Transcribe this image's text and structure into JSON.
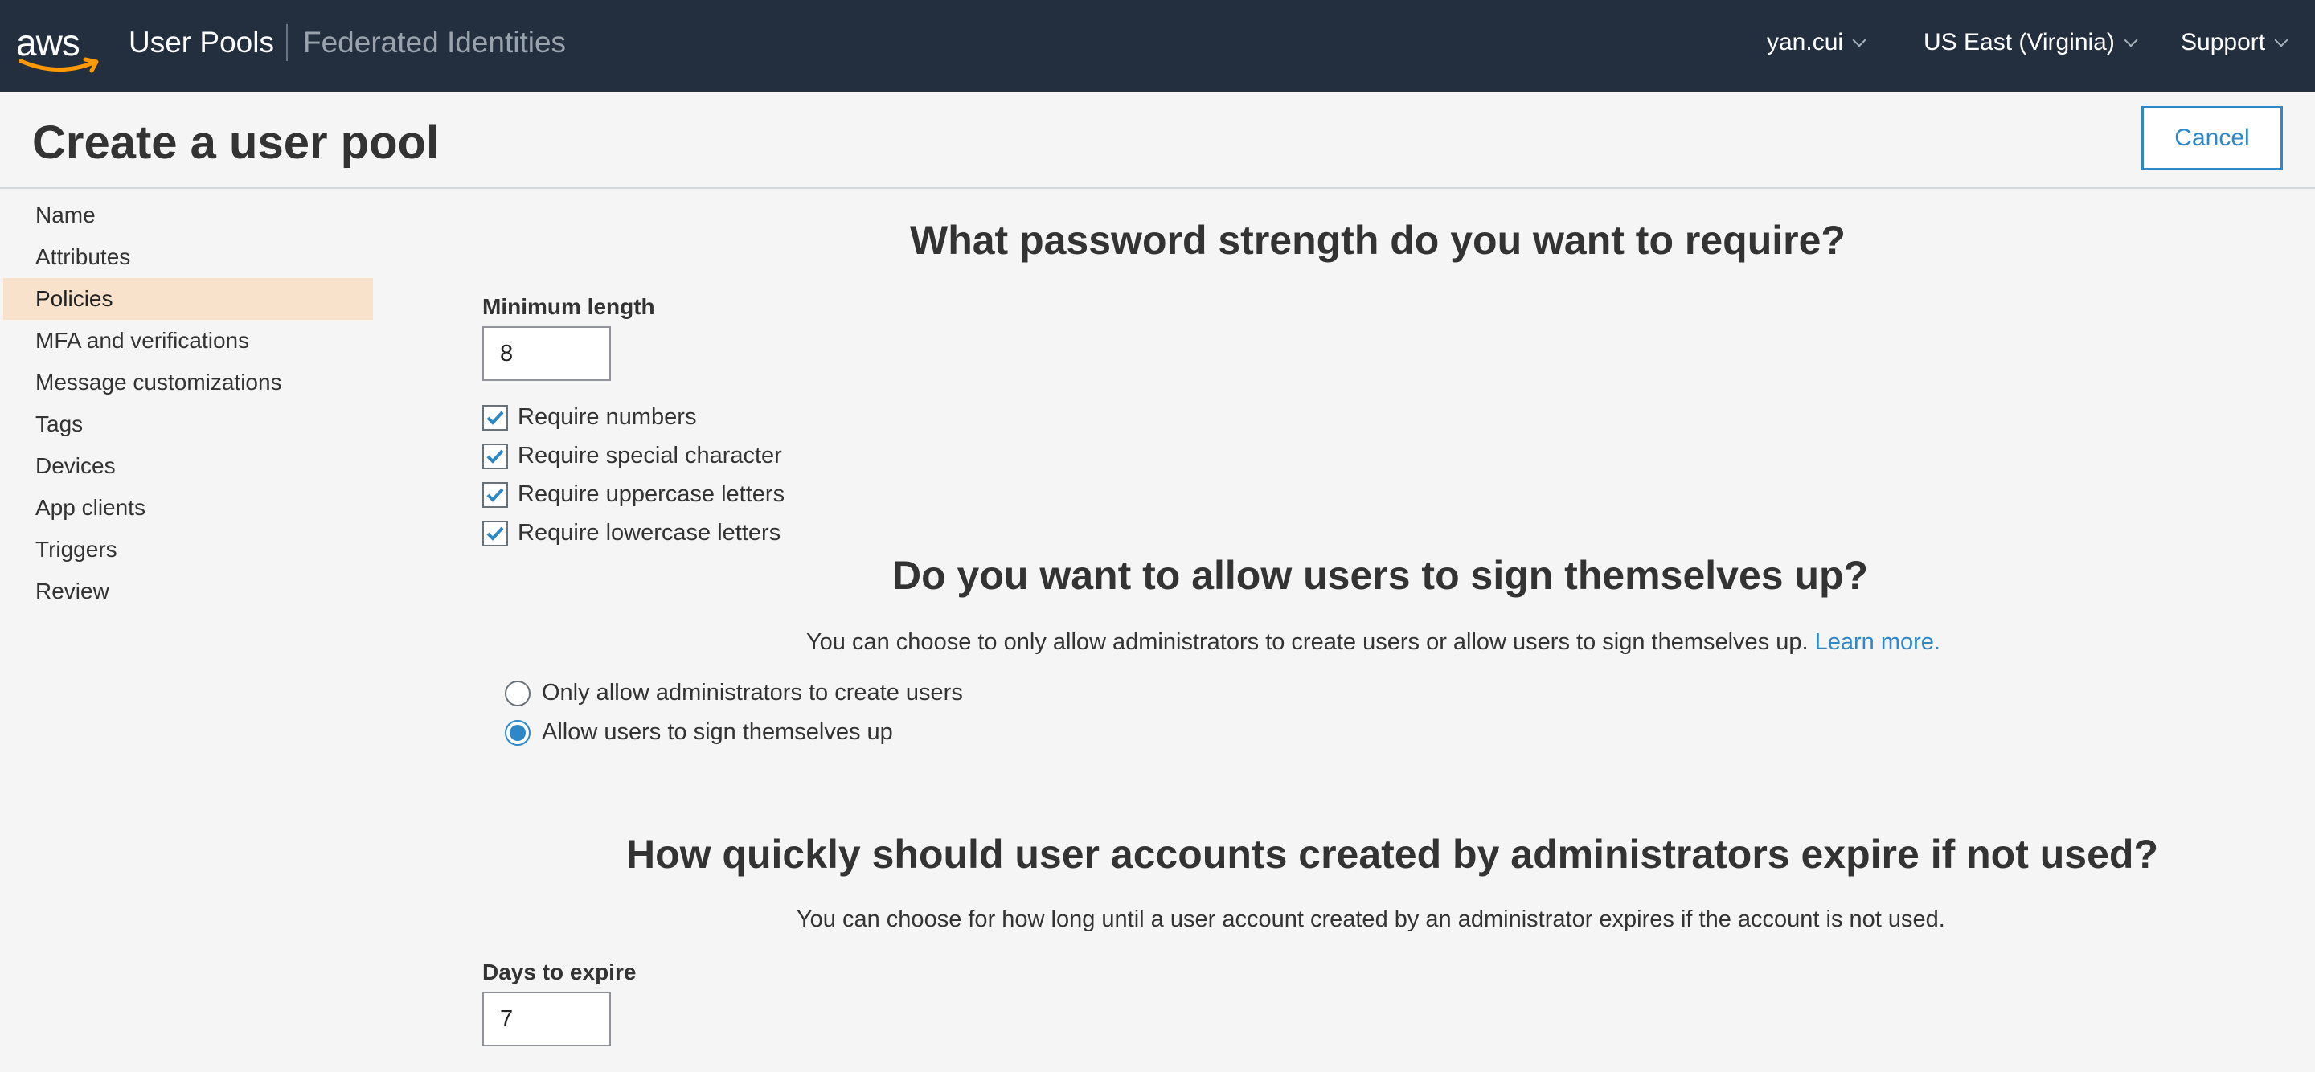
{
  "topnav": {
    "logo_text": "aws",
    "user_pools": "User Pools",
    "federated_identities": "Federated Identities",
    "user": "yan.cui",
    "region": "US East (Virginia)",
    "support": "Support"
  },
  "header": {
    "title": "Create a user pool",
    "cancel_label": "Cancel"
  },
  "sidebar": {
    "items": [
      {
        "label": "Name"
      },
      {
        "label": "Attributes"
      },
      {
        "label": "Policies",
        "active": true
      },
      {
        "label": "MFA and verifications"
      },
      {
        "label": "Message customizations"
      },
      {
        "label": "Tags"
      },
      {
        "label": "Devices"
      },
      {
        "label": "App clients"
      },
      {
        "label": "Triggers"
      },
      {
        "label": "Review"
      }
    ]
  },
  "password": {
    "heading": "What password strength do you want to require?",
    "min_length_label": "Minimum length",
    "min_length_value": "8",
    "checks": [
      {
        "label": "Require numbers",
        "checked": true
      },
      {
        "label": "Require special character",
        "checked": true
      },
      {
        "label": "Require uppercase letters",
        "checked": true
      },
      {
        "label": "Require lowercase letters",
        "checked": true
      }
    ]
  },
  "signup": {
    "heading": "Do you want to allow users to sign themselves up?",
    "description": "You can choose to only allow administrators to create users or allow users to sign themselves up.",
    "learn_more": "Learn more.",
    "options": [
      {
        "label": "Only allow administrators to create users",
        "selected": false
      },
      {
        "label": "Allow users to sign themselves up",
        "selected": true
      }
    ]
  },
  "expire": {
    "heading": "How quickly should user accounts created by administrators expire if not used?",
    "description": "You can choose for how long until a user account created by an administrator expires if the account is not used.",
    "days_label": "Days to expire",
    "days_value": "7"
  },
  "colors": {
    "nav_bg": "#232f3e",
    "accent": "#2e87c6",
    "active_item_bg": "#f8e2cc",
    "page_bg": "#f4f5f4"
  }
}
